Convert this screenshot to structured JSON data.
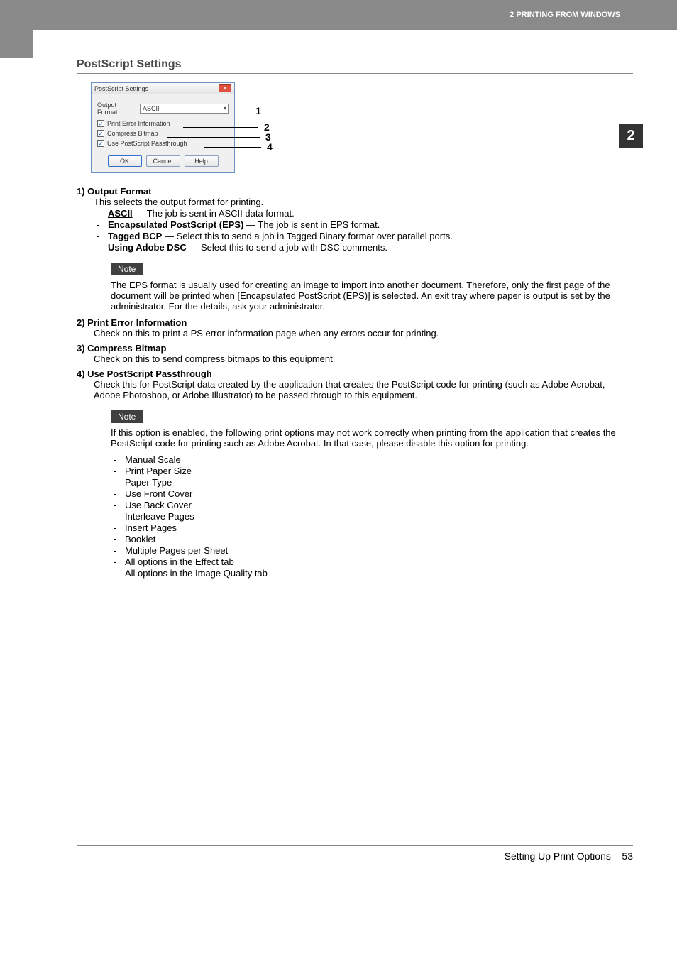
{
  "header": {
    "breadcrumb": "2 PRINTING FROM WINDOWS"
  },
  "side_tab": "2",
  "section_title": "PostScript Settings",
  "dialog": {
    "title": "PostScript Settings",
    "output_format_label": "Output Format:",
    "output_format_value": "ASCII",
    "check1": "Print Error Information",
    "check2": "Compress Bitmap",
    "check3": "Use PostScript Passthrough",
    "btn_ok": "OK",
    "btn_cancel": "Cancel",
    "btn_help": "Help"
  },
  "callouts": {
    "c1": "1",
    "c2": "2",
    "c3": "3",
    "c4": "4"
  },
  "items": {
    "i1_head": "1)  Output Format",
    "i1_desc": "This selects the output format for printing.",
    "i1_opts": [
      {
        "term": "ASCII",
        "underline": true,
        "text": " — The job is sent in ASCII data format."
      },
      {
        "term": "Encapsulated PostScript (EPS)",
        "underline": false,
        "text": " — The job is sent in EPS format."
      },
      {
        "term": "Tagged BCP",
        "underline": false,
        "text": " — Select this to send a job in Tagged Binary format over parallel ports."
      },
      {
        "term": "Using Adobe DSC",
        "underline": false,
        "text": " — Select this to send a job with DSC comments."
      }
    ],
    "note1_label": "Note",
    "note1_text": "The EPS format is usually used for creating an image to import into another document.  Therefore, only the first page of the document will be printed when [Encapsulated PostScript (EPS)] is selected.  An exit tray where paper is output is set by the administrator. For the details, ask your administrator.",
    "i2_head": "2)  Print Error Information",
    "i2_desc": "Check on this to print a PS error information page when any errors occur for printing.",
    "i3_head": "3)  Compress Bitmap",
    "i3_desc": "Check on this to send compress bitmaps to this equipment.",
    "i4_head": "4)  Use PostScript Passthrough",
    "i4_desc": "Check this for PostScript data created by the application that creates the PostScript code for printing (such as Adobe Acrobat, Adobe Photoshop, or Adobe Illustrator) to be passed through to this equipment.",
    "note2_label": "Note",
    "note2_text": "If this option is enabled, the following print options may not work correctly when printing from the application that creates the PostScript code for printing such as Adobe Acrobat.  In that case, please disable this option for printing.",
    "note2_list": [
      "Manual Scale",
      "Print Paper Size",
      "Paper Type",
      "Use Front Cover",
      "Use Back Cover",
      "Interleave Pages",
      "Insert Pages",
      "Booklet",
      "Multiple Pages per Sheet",
      "All options in the Effect tab",
      "All options in the Image Quality tab"
    ]
  },
  "footer": {
    "text": "Setting Up Print Options",
    "page": "53"
  }
}
